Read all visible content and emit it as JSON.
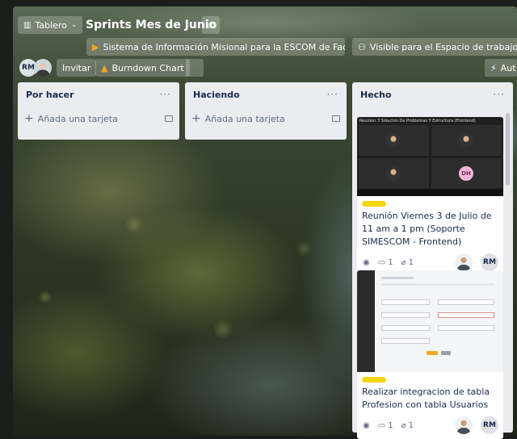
{
  "header": {
    "view_switch": "Tablero",
    "board_title": "Sprints Mes de Junio",
    "workspace": "Sistema de Información Misional para la ESCOM de Facatativá ...",
    "visibility": "Visible para el Espacio de trabajo",
    "avatar_initials": "RM",
    "invite": "Invitar",
    "powerup": "Burndown Chart",
    "automation": "Aut"
  },
  "lists": [
    {
      "title": "Por hacer",
      "menu": "···",
      "add_card": "Añada una tarjeta"
    },
    {
      "title": "Haciendo",
      "menu": "···",
      "add_card": "Añada una tarjeta"
    },
    {
      "title": "Hecho",
      "menu": "···"
    }
  ],
  "cards": [
    {
      "cover_title": "Reunion 3 Solucion De Problemas Y Estructura (Frontend)",
      "title": "Reunión Viernes 3 de Julio de 11 am a 1 pm (Soporte SIMESCOM - Frontend)",
      "comments": "1",
      "attachments": "1",
      "member_initials": "RM",
      "participant_initials": "DH"
    },
    {
      "title": "Realizar integracion de tabla Profesion con tabla Usuarios",
      "comments": "1",
      "attachments": "1",
      "member_initials": "RM"
    }
  ],
  "colors": {
    "label": "#f2d600",
    "list_bg": "#ebecf0",
    "text": "#172b4d"
  }
}
